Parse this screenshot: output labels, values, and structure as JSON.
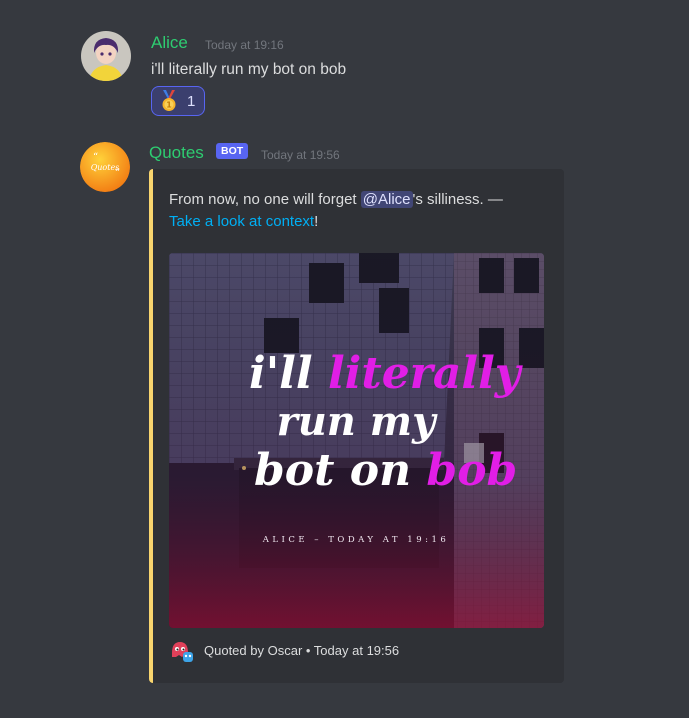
{
  "messages": [
    {
      "author": "Alice",
      "author_color": "#2ecc71",
      "timestamp": "Today at 19:16",
      "content": "i'll literally run my bot on bob",
      "reaction": {
        "emoji": "first-place-medal-icon",
        "count": "1"
      }
    },
    {
      "author": "Quotes",
      "author_color": "#2ecc71",
      "bot_tag": "BOT",
      "timestamp": "Today at 19:56",
      "avatar_text": "Quotes",
      "embed": {
        "accent_color": "#f9d56e",
        "description_prefix": "From now, no one will forget ",
        "mention": "@Alice",
        "description_suffix": "'s silliness. —",
        "link_text": "Take a look at context",
        "link_suffix": "!",
        "image": {
          "line1_plain": "i'll ",
          "line1_accent": "literally",
          "line2": "run my",
          "line3_plain": "bot on ",
          "line3_accent": "bob",
          "caption": "ALICE – TODAY AT 19:16",
          "accent_color": "#e11ee6"
        },
        "footer": "Quoted by Oscar • Today at 19:56"
      }
    }
  ]
}
